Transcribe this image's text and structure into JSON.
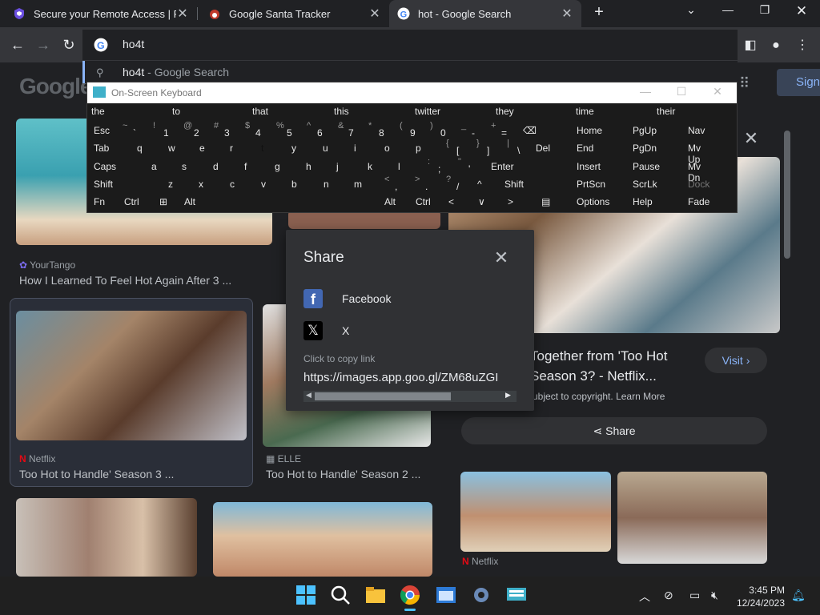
{
  "tabs": [
    {
      "title": "Secure your Remote Access | Per"
    },
    {
      "title": "Google Santa Tracker"
    },
    {
      "title": "hot - Google Search"
    }
  ],
  "omnibox": {
    "text": "ho4t",
    "suggestion_bold": "ho4t",
    "suggestion_rest": " - Google Search"
  },
  "google": {
    "logo": "Google",
    "signin": "Sign"
  },
  "results": [
    {
      "source": "YourTango",
      "caption": "How I Learned To Feel Hot Again After 3 ..."
    },
    {
      "source": "Netflix",
      "caption": "Too Hot to Handle' Season 3 ..."
    },
    {
      "source": "ELLE",
      "caption": "Too Hot to Handle' Season 2 ..."
    }
  ],
  "panel": {
    "title": "Together from 'Too Hot Season 3? - Netflix...",
    "visit": "Visit",
    "copyright": "ubject to copyright.",
    "learn_more": "Learn More",
    "share": "Share",
    "related_source": "Netflix"
  },
  "osk": {
    "title": "On-Screen Keyboard",
    "predictions": [
      "the",
      "to",
      "that",
      "this",
      "twitter",
      "they",
      "time",
      "their"
    ],
    "rows": [
      [
        {
          "l": "Esc"
        },
        {
          "s": "~",
          "m": "`"
        },
        {
          "s": "!",
          "m": "1"
        },
        {
          "s": "@",
          "m": "2"
        },
        {
          "s": "#",
          "m": "3"
        },
        {
          "s": "$",
          "m": "4"
        },
        {
          "s": "%",
          "m": "5"
        },
        {
          "s": "^",
          "m": "6"
        },
        {
          "s": "&",
          "m": "7"
        },
        {
          "s": "*",
          "m": "8"
        },
        {
          "s": "(",
          "m": "9"
        },
        {
          "s": ")",
          "m": "0"
        },
        {
          "s": "_",
          "m": "-"
        },
        {
          "s": "+",
          "m": "="
        },
        {
          "l": "⌫"
        },
        {
          "l": "Home"
        },
        {
          "l": "PgUp"
        },
        {
          "l": "Nav"
        }
      ],
      [
        {
          "l": "Tab"
        },
        {
          "l": "q"
        },
        {
          "l": "w"
        },
        {
          "l": "e"
        },
        {
          "l": "r"
        },
        {
          "l": "t"
        },
        {
          "l": "y"
        },
        {
          "l": "u"
        },
        {
          "l": "i"
        },
        {
          "l": "o"
        },
        {
          "l": "p"
        },
        {
          "s": "{",
          "m": "["
        },
        {
          "s": "}",
          "m": "]"
        },
        {
          "s": "|",
          "m": "\\"
        },
        {
          "l": "Del"
        },
        {
          "l": "End"
        },
        {
          "l": "PgDn"
        },
        {
          "l": "Mv Up"
        }
      ],
      [
        {
          "l": "Caps"
        },
        {
          "l": "a"
        },
        {
          "l": "s"
        },
        {
          "l": "d"
        },
        {
          "l": "f"
        },
        {
          "l": "g"
        },
        {
          "l": "h"
        },
        {
          "l": "j"
        },
        {
          "l": "k"
        },
        {
          "l": "l"
        },
        {
          "s": ":",
          "m": ";"
        },
        {
          "s": "\"",
          "m": "'"
        },
        {
          "l": "Enter"
        },
        {
          "l": "Insert"
        },
        {
          "l": "Pause"
        },
        {
          "l": "Mv Dn"
        }
      ],
      [
        {
          "l": "Shift"
        },
        {
          "l": "z"
        },
        {
          "l": "x"
        },
        {
          "l": "c"
        },
        {
          "l": "v"
        },
        {
          "l": "b"
        },
        {
          "l": "n"
        },
        {
          "l": "m"
        },
        {
          "s": "<",
          "m": ","
        },
        {
          "s": ">",
          "m": "."
        },
        {
          "s": "?",
          "m": "/"
        },
        {
          "l": "^"
        },
        {
          "l": "Shift"
        },
        {
          "l": "PrtScn"
        },
        {
          "l": "ScrLk"
        },
        {
          "l": "Dock"
        }
      ],
      [
        {
          "l": "Fn"
        },
        {
          "l": "Ctrl"
        },
        {
          "l": "⊞"
        },
        {
          "l": "Alt"
        },
        {
          "l": ""
        },
        {
          "l": "Alt"
        },
        {
          "l": "Ctrl"
        },
        {
          "l": "<"
        },
        {
          "l": "∨"
        },
        {
          "l": ">"
        },
        {
          "l": "▤"
        },
        {
          "l": "Options"
        },
        {
          "l": "Help"
        },
        {
          "l": "Fade"
        }
      ]
    ]
  },
  "share_dialog": {
    "title": "Share",
    "facebook": "Facebook",
    "x": "X",
    "hint": "Click to copy link",
    "url": "https://images.app.goo.gl/ZM68uZGI"
  },
  "taskbar": {
    "time": "3:45 PM",
    "date": "12/24/2023"
  },
  "icons": [
    "vpn-shield-icon",
    "santa-icon",
    "google-g-icon",
    "back-icon",
    "forward-icon",
    "reload-icon",
    "sidebar-icon",
    "profile-icon",
    "menu-icon",
    "search-icon",
    "close-icon",
    "windows-icon",
    "taskbar-search-icon",
    "explorer-icon",
    "chrome-icon",
    "settings-icon",
    "osk-icon",
    "bell-icon"
  ]
}
